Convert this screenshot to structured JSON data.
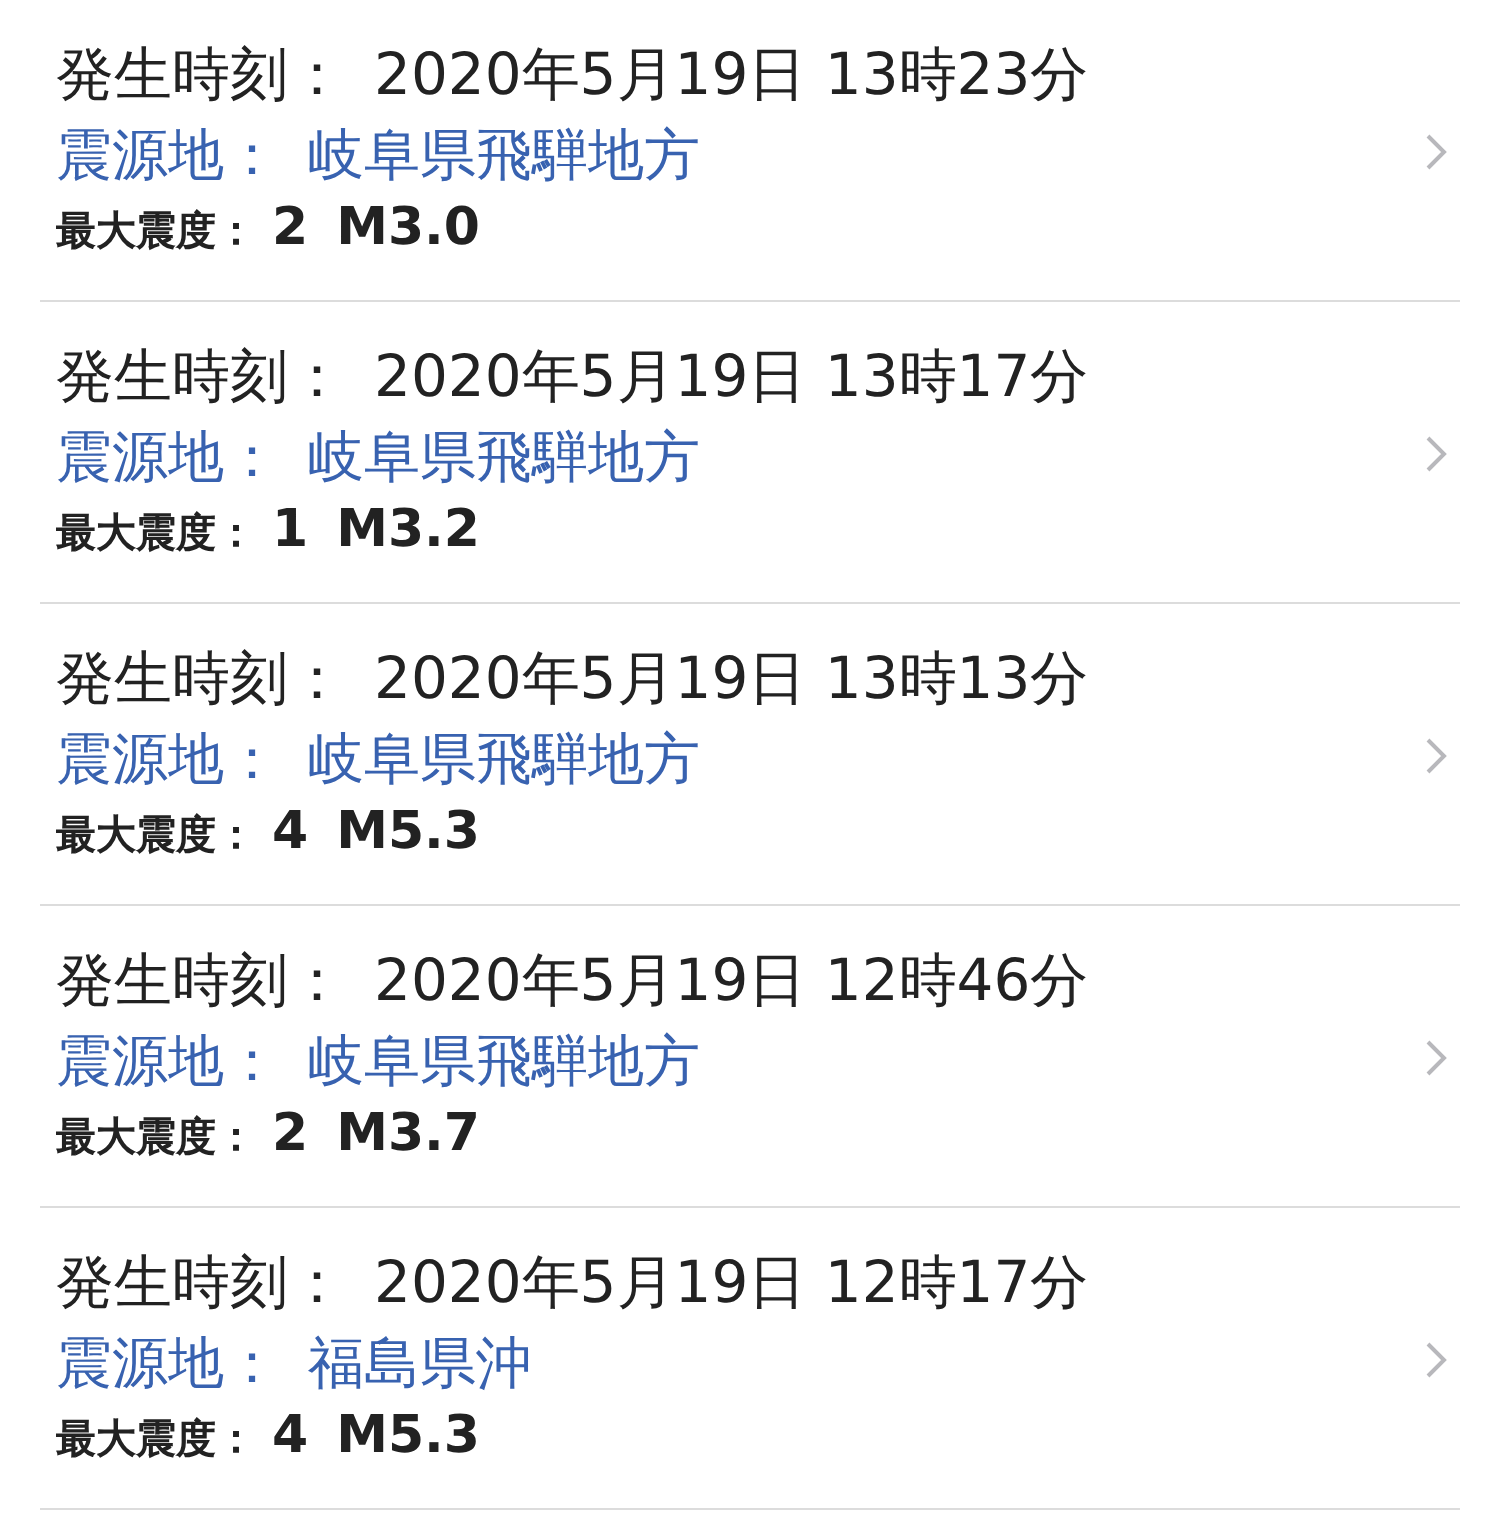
{
  "events": [
    {
      "time_label": "発生時刻：",
      "time": "2020年5月19日 13時23分",
      "epicenter_label": "震源地：",
      "epicenter": "岐阜県飛騨地方",
      "intensity_label": "最大震度：",
      "intensity": "2",
      "magnitude": "M3.0"
    },
    {
      "time_label": "発生時刻：",
      "time": "2020年5月19日 13時17分",
      "epicenter_label": "震源地：",
      "epicenter": "岐阜県飛騨地方",
      "intensity_label": "最大震度：",
      "intensity": "1",
      "magnitude": "M3.2"
    },
    {
      "time_label": "発生時刻：",
      "time": "2020年5月19日 13時13分",
      "epicenter_label": "震源地：",
      "epicenter": "岐阜県飛騨地方",
      "intensity_label": "最大震度：",
      "intensity": "4",
      "magnitude": "M5.3"
    },
    {
      "time_label": "発生時刻：",
      "time": "2020年5月19日 12時46分",
      "epicenter_label": "震源地：",
      "epicenter": "岐阜県飛騨地方",
      "intensity_label": "最大震度：",
      "intensity": "2",
      "magnitude": "M3.7"
    },
    {
      "time_label": "発生時刻：",
      "time": "2020年5月19日 12時17分",
      "epicenter_label": "震源地：",
      "epicenter": "福島県沖",
      "intensity_label": "最大震度：",
      "intensity": "4",
      "magnitude": "M5.3"
    }
  ]
}
